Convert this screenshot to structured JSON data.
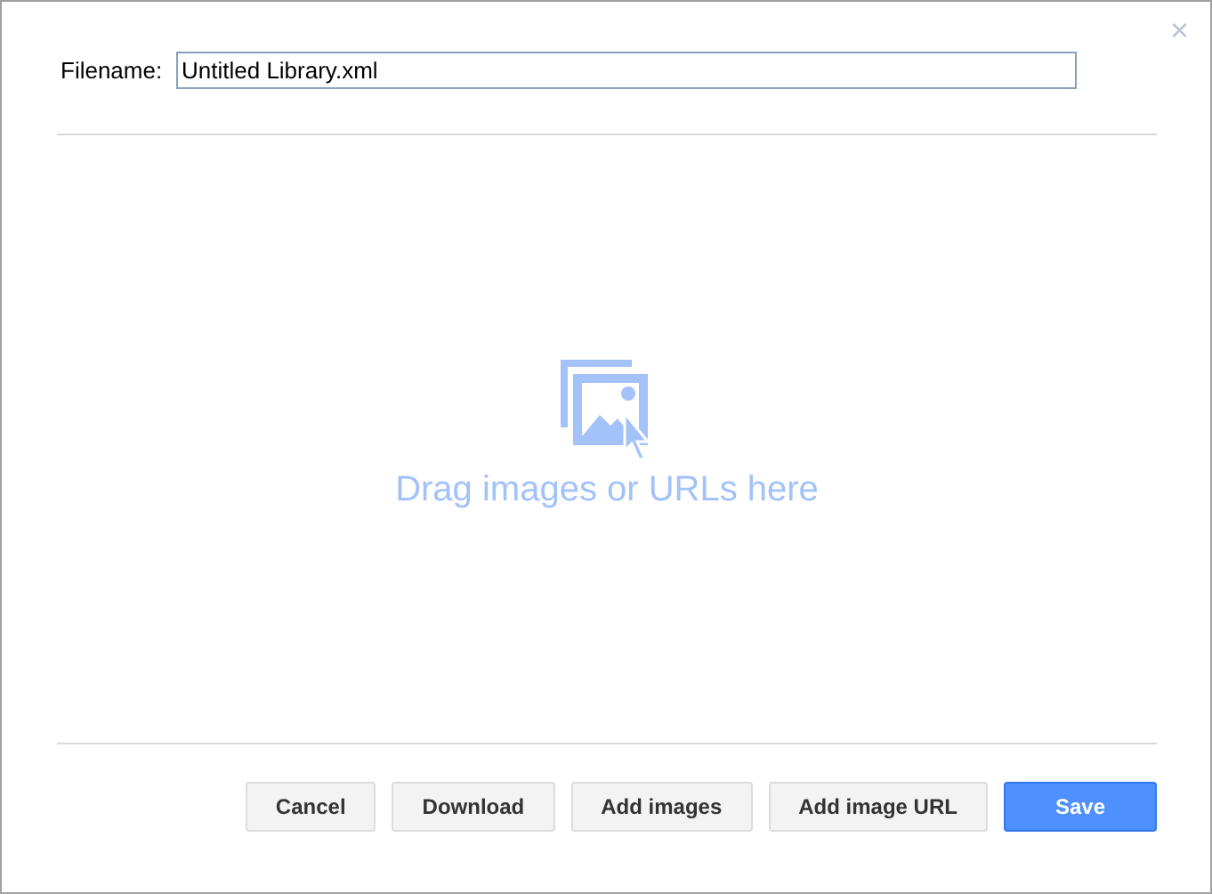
{
  "close": "×",
  "filename": {
    "label": "Filename:",
    "value": "Untitled Library.xml"
  },
  "drop_zone": {
    "text": "Drag images or URLs here"
  },
  "buttons": [
    {
      "label": "Cancel",
      "kind": "default"
    },
    {
      "label": "Download",
      "kind": "default"
    },
    {
      "label": "Add images",
      "kind": "default"
    },
    {
      "label": "Add image URL",
      "kind": "default"
    },
    {
      "label": "Save",
      "kind": "primary"
    }
  ]
}
